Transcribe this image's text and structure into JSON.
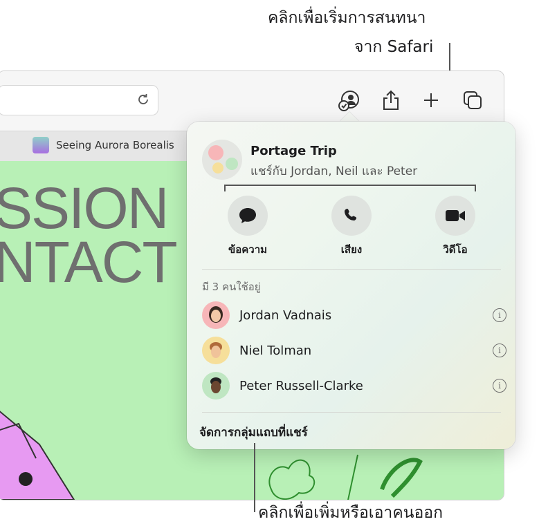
{
  "callouts": {
    "top_line1": "คลิกเพื่อเริ่มการสนทนา",
    "top_line2": "จาก Safari",
    "bottom": "คลิกเพื่อเพิ่มหรือเอาคนออก"
  },
  "browser": {
    "tab_label": "Seeing Aurora Borealis",
    "headline_line1": "SSION",
    "headline_line2": "NTACT"
  },
  "popover": {
    "group_title": "Portage Trip",
    "group_subtitle": "แชร์กับ Jordan, Neil และ Peter",
    "actions": [
      {
        "label": "ข้อความ",
        "icon": "message-icon"
      },
      {
        "label": "เสียง",
        "icon": "phone-icon"
      },
      {
        "label": "วิดีโอ",
        "icon": "video-icon"
      }
    ],
    "section_header": "มี 3 คนใช้อยู่",
    "people": [
      {
        "name": "Jordan Vadnais",
        "avatar_color": "#f7b6b8"
      },
      {
        "name": "Niel Tolman",
        "avatar_color": "#f6df9a"
      },
      {
        "name": "Peter Russell-Clarke",
        "avatar_color": "#bfe6c2"
      }
    ],
    "manage_label": "จัดการกลุ่มแถบที่แชร์"
  },
  "colors": {
    "page_background": "#b8f0b6",
    "headline": "#6f6f6f"
  }
}
